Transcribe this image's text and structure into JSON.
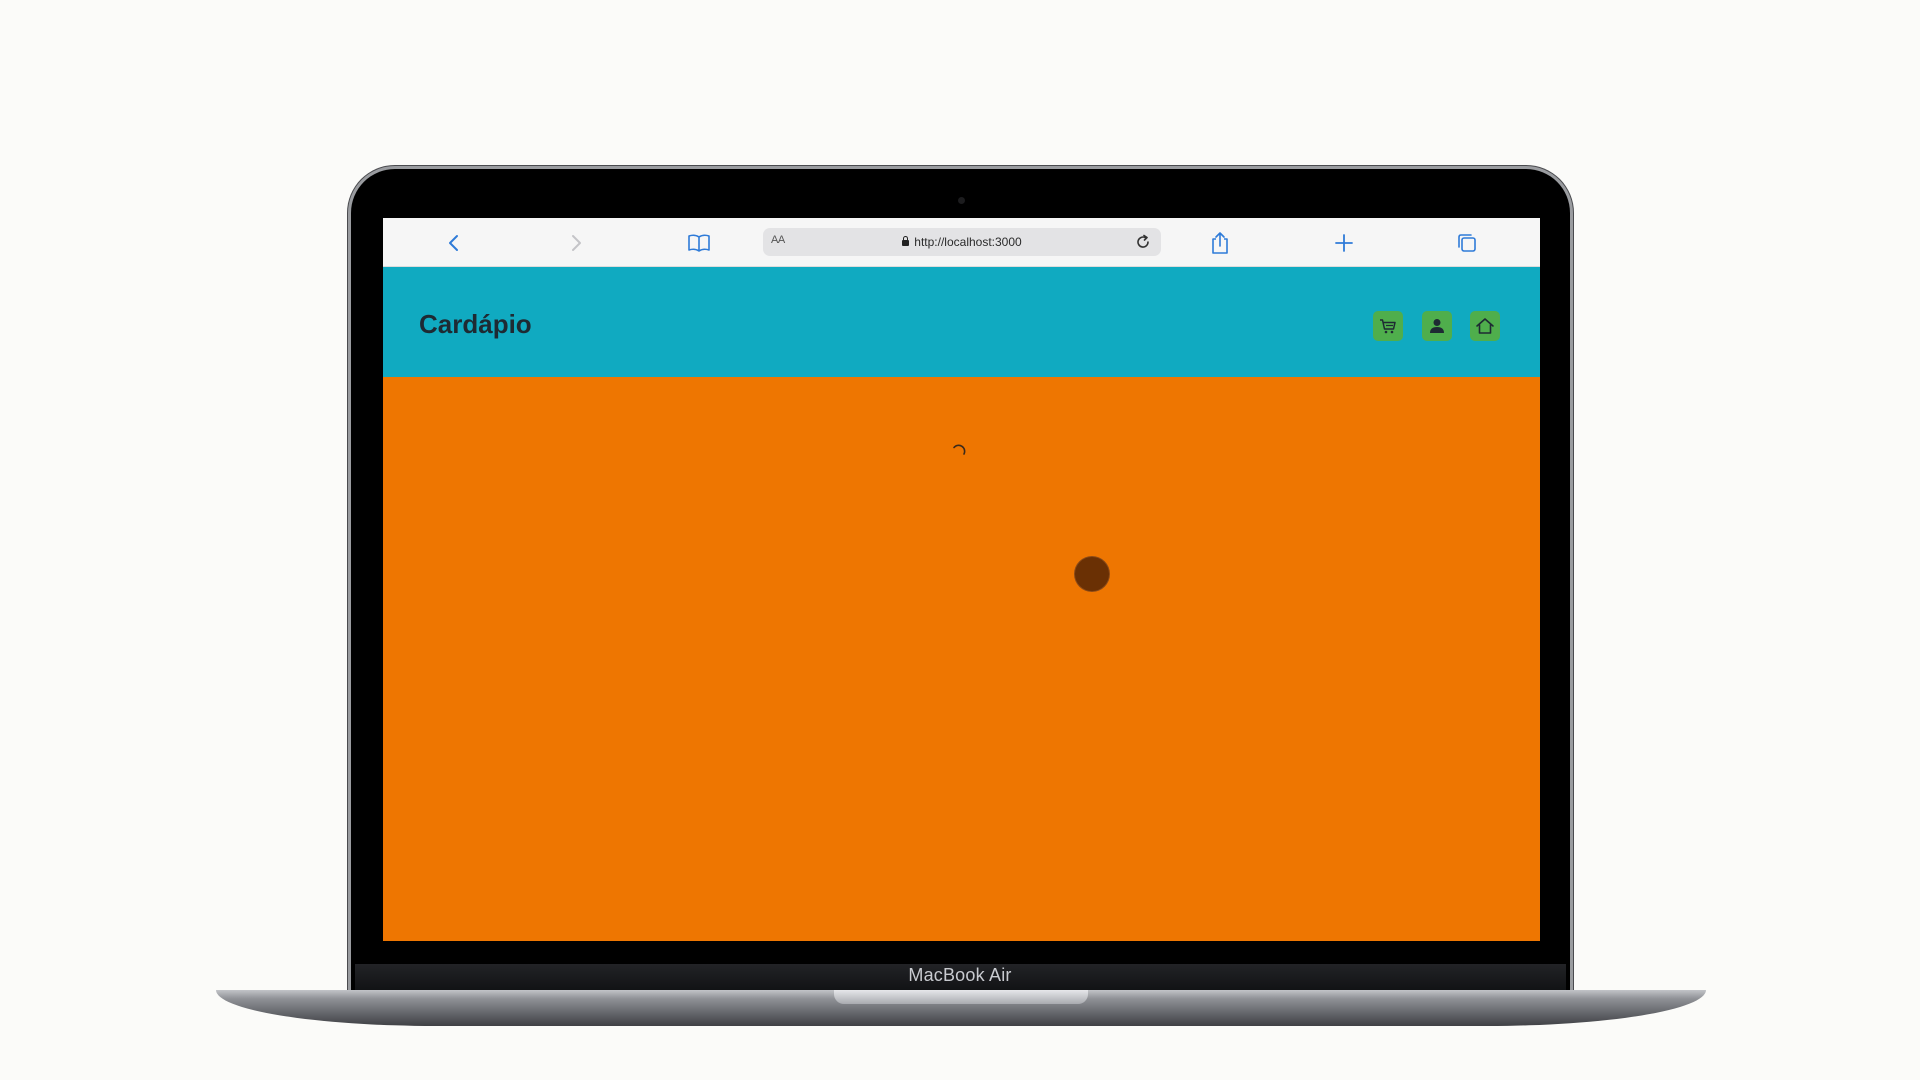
{
  "browser": {
    "reader_label": "AA",
    "url": "http://localhost:3000",
    "toolbar": {
      "back_icon": "chevron-left-icon",
      "forward_icon": "chevron-right-icon",
      "bookmarks_icon": "book-icon",
      "reload_icon": "reload-icon",
      "share_icon": "share-icon",
      "new_tab_icon": "plus-icon",
      "tabs_icon": "tabs-icon"
    }
  },
  "app": {
    "title": "Cardápio",
    "header_color": "#10aac1",
    "background_color": "#ee7601",
    "icon_button_color": "#4fae4c",
    "header_icons": [
      "cart-icon",
      "user-icon",
      "home-icon"
    ],
    "loading": true
  },
  "device": {
    "label": "MacBook Air"
  }
}
